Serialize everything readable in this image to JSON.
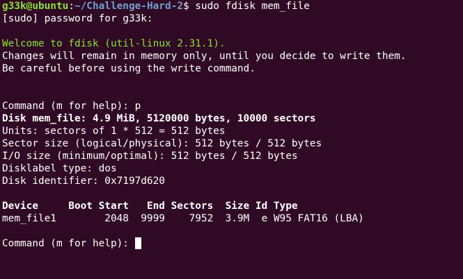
{
  "prompt": {
    "user_host": "g33k@ubuntu",
    "separator": ":",
    "path": "~/Challenge-Hard-2",
    "symbol": "$",
    "command": " sudo fdisk mem_file"
  },
  "lines": {
    "sudo_password": "[sudo] password for g33k:",
    "welcome": "Welcome to fdisk (util-linux 2.31.1).",
    "changes": "Changes will remain in memory only, until you decide to write them.",
    "careful": "Be careful before using the write command.",
    "command_p": "Command (m for help): p",
    "disk_info": "Disk mem_file: 4.9 MiB, 5120000 bytes, 10000 sectors",
    "units": "Units: sectors of 1 * 512 = 512 bytes",
    "sector_size": "Sector size (logical/physical): 512 bytes / 512 bytes",
    "io_size": "I/O size (minimum/optimal): 512 bytes / 512 bytes",
    "disklabel": "Disklabel type: dos",
    "identifier": "Disk identifier: 0x7197d620",
    "table_header": "Device     Boot Start   End Sectors  Size Id Type",
    "table_row": "mem_file1        2048  9999    7952  3.9M  e W95 FAT16 (LBA)",
    "command_prompt": "Command (m for help): "
  }
}
